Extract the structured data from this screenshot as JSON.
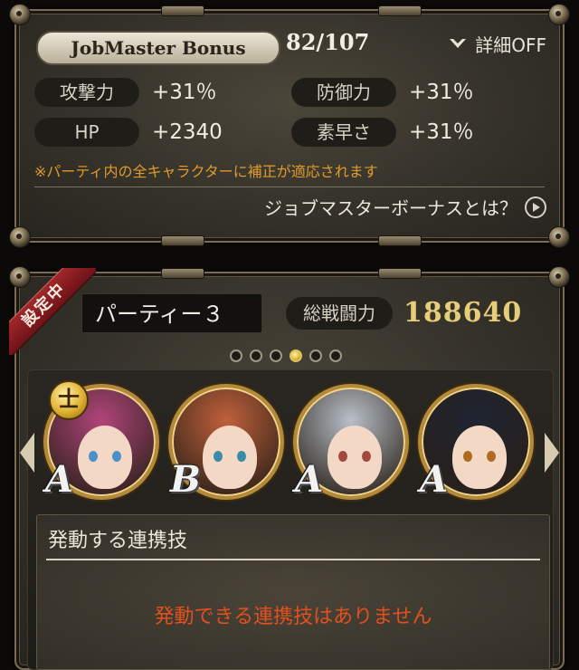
{
  "bonus": {
    "title": "JobMaster Bonus",
    "progress": "82/107",
    "detail_toggle": "詳細OFF",
    "stats": [
      {
        "label": "攻撃力",
        "value": "+31％"
      },
      {
        "label": "防御力",
        "value": "+31％"
      },
      {
        "label": "HP",
        "value": "+2340"
      },
      {
        "label": "素早さ",
        "value": "+31％"
      }
    ],
    "note": "※パーティ内の全キャラクターに補正が適応されます",
    "help_link": "ジョブマスターボーナスとは？"
  },
  "party": {
    "ribbon": "設定中",
    "name": "パーティー３",
    "power_label": "総戦闘力",
    "power_value": "188640",
    "page_count": 6,
    "active_page": 4,
    "leader_badge": "士",
    "members": [
      {
        "rank": "A",
        "hair": "#b0457a",
        "eye": "#4a90c8"
      },
      {
        "rank": "B",
        "hair": "#c0603a",
        "eye": "#3a8aa8"
      },
      {
        "rank": "A",
        "hair": "#b8c0c8",
        "eye": "#a04a3a"
      },
      {
        "rank": "A",
        "hair": "#1e2432",
        "eye": "#b06a20"
      }
    ],
    "combo_title": "発動する連携技",
    "combo_empty": "発動できる連携技はありません"
  },
  "colors": {
    "note": "#e09a2c",
    "combo_empty": "#e2501e",
    "power_value": "#e6cd7a",
    "ribbon": "#a3262b"
  }
}
